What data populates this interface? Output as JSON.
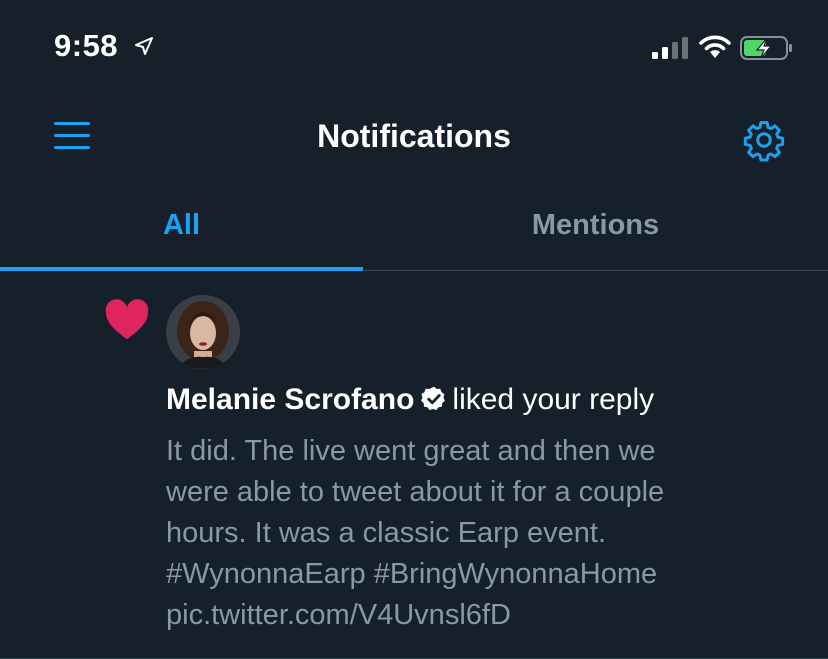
{
  "status_bar": {
    "time": "9:58",
    "location_icon": "location-arrow-icon",
    "signal_icon": "cellular-signal-icon",
    "wifi_icon": "wifi-icon",
    "battery_icon": "battery-charging-icon",
    "battery_level": 0.55
  },
  "header": {
    "title": "Notifications",
    "menu_icon": "hamburger-menu-icon",
    "settings_icon": "gear-icon"
  },
  "tabs": [
    {
      "label": "All",
      "active": true
    },
    {
      "label": "Mentions",
      "active": false
    }
  ],
  "notification": {
    "type_icon": "heart-icon",
    "user_name": "Melanie Scrofano",
    "verified": true,
    "action": "liked your reply",
    "tweet_lines": [
      "It did. The live went great and then we",
      "were able to tweet about it for a couple",
      "hours. It was a classic Earp event.",
      "#WynonnaEarp #BringWynonnaHome",
      "pic.twitter.com/V4Uvnsl6fD"
    ]
  },
  "colors": {
    "background": "#15202b",
    "accent": "#1da1f2",
    "like_red": "#e0245e",
    "muted_text": "#8899a6",
    "divider": "#38444d",
    "battery_green": "#4cd964"
  }
}
